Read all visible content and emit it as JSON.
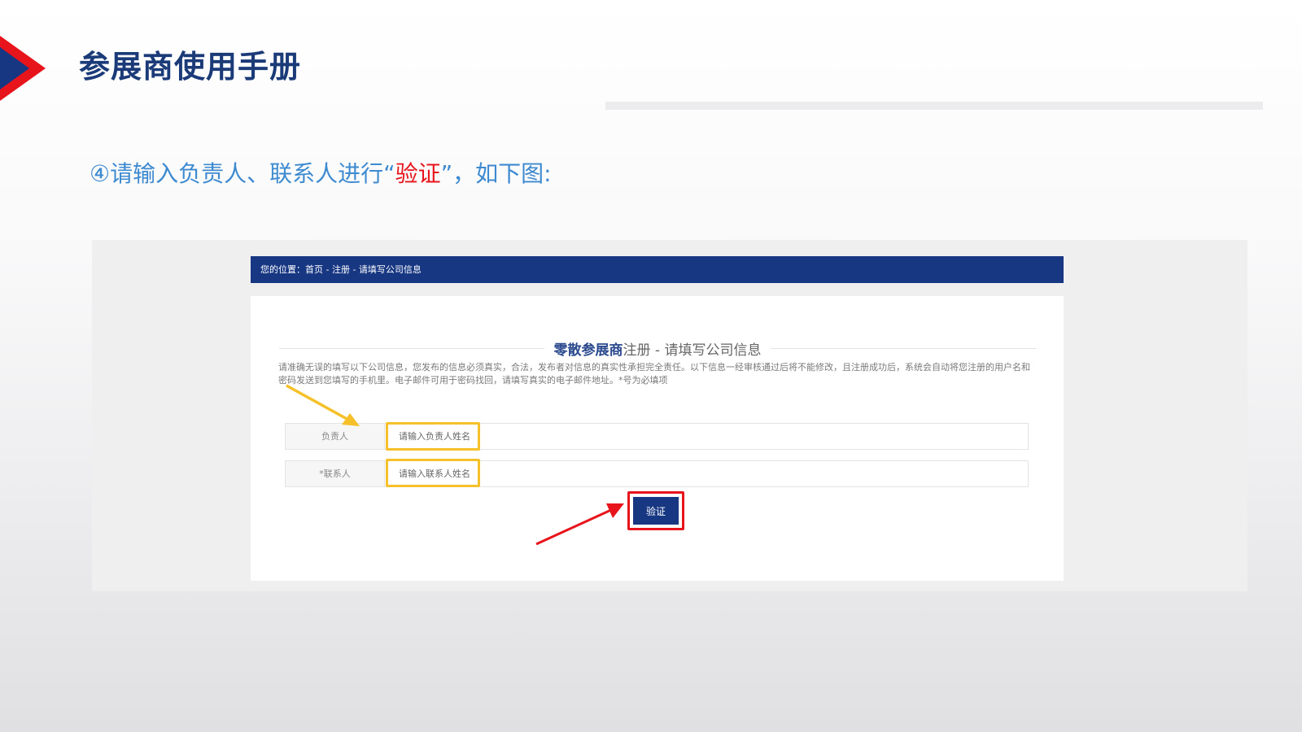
{
  "slide": {
    "title": "参展商使用手册",
    "instruction": {
      "prefix": "④请输入负责人、联系人进行“",
      "highlight": "验证",
      "suffix": "”，如下图:"
    },
    "colors": {
      "brand_blue": "#173783",
      "title_blue": "#1a3a78",
      "instruction_blue": "#3e8ad0",
      "highlight_red": "#e8141c",
      "annotation_yellow": "#f5c02a"
    }
  },
  "screenshot": {
    "breadcrumb": "您的位置：首页 - 注册 - 请填写公司信息",
    "form": {
      "heading_strong": "零散参展商",
      "heading_rest": "注册 - 请填写公司信息",
      "notice": "请准确无误的填写以下公司信息，您发布的信息必须真实，合法，发布者对信息的真实性承担完全责任。以下信息一经审核通过后将不能修改，且注册成功后，系统会自动将您注册的用户名和密码发送到您填写的手机里。电子邮件可用于密码找回，请填写真实的电子邮件地址。*号为必填项",
      "fields": [
        {
          "label": "负责人",
          "placeholder": "请输入负责人姓名",
          "value": ""
        },
        {
          "label": "*联系人",
          "placeholder": "请输入联系人姓名",
          "value": ""
        }
      ],
      "verify_label": "验证"
    },
    "annotations": {
      "yellow_arrow": "arrow pointing to owner input",
      "red_arrow": "arrow pointing to verify button"
    }
  }
}
